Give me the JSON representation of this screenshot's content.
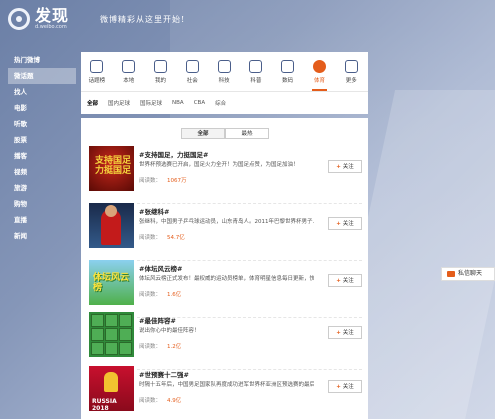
{
  "header": {
    "title": "发现",
    "subtitle": "d.weibo.com",
    "slogan": "微博精彩从这里开始!"
  },
  "sidebar": {
    "items": [
      {
        "label": "热门微博"
      },
      {
        "label": "微话题",
        "active": true
      },
      {
        "label": "找人"
      },
      {
        "label": "电影"
      },
      {
        "label": "听歌"
      },
      {
        "label": "股票"
      },
      {
        "label": "播客"
      },
      {
        "label": "视频"
      },
      {
        "label": "旅游"
      },
      {
        "label": "购物"
      },
      {
        "label": "直播"
      },
      {
        "label": "新闻"
      }
    ]
  },
  "categories": {
    "items": [
      {
        "label": "话题榜",
        "icon": "trophy-icon"
      },
      {
        "label": "本地",
        "icon": "location-icon"
      },
      {
        "label": "我的",
        "icon": "user-icon"
      },
      {
        "label": "社会",
        "icon": "globe-icon"
      },
      {
        "label": "科技",
        "icon": "ie-icon"
      },
      {
        "label": "科普",
        "icon": "book-icon"
      },
      {
        "label": "数码",
        "icon": "phone-icon"
      },
      {
        "label": "体育",
        "icon": "ball-icon",
        "selected": true
      },
      {
        "label": "更多",
        "icon": "more-icon"
      }
    ]
  },
  "subcats": {
    "items": [
      {
        "label": "全部",
        "selected": true
      },
      {
        "label": "国内足球"
      },
      {
        "label": "国际足球"
      },
      {
        "label": "NBA"
      },
      {
        "label": "CBA"
      },
      {
        "label": "综合"
      }
    ]
  },
  "tabs": {
    "all": "全部",
    "hot": "最热"
  },
  "topics": [
    {
      "title": "#支持国足，力挺国足#",
      "desc": "世界杯预选赛已开启，国足火力全开！为国足点赞，为国足加油！",
      "reads_label": "阅读数：",
      "reads": "1067万",
      "follow": "关注",
      "thumb_text": "支持国足力挺国足"
    },
    {
      "title": "#张继科#",
      "desc": "张继科，中国男子乒乓球运动员，山东青岛人。2011年巴黎世界杯男子...",
      "reads_label": "阅读数：",
      "reads": "54.7亿",
      "follow": "关注"
    },
    {
      "title": "#体坛风云榜#",
      "desc": "体坛风云榜正式发布！最权威的运动员榜单，体育明星信息每日更新，快...",
      "reads_label": "阅读数：",
      "reads": "1.6亿",
      "follow": "关注",
      "thumb_text": "体坛风云榜"
    },
    {
      "title": "#最佳阵容#",
      "desc": "说出你心中的最佳阵容！",
      "reads_label": "阅读数：",
      "reads": "1.2亿",
      "follow": "关注"
    },
    {
      "title": "#世预赛十二强#",
      "desc": "时隔十五年后，中国男足国家队再度成功进军世界杯亚洲区预选赛的最后...",
      "reads_label": "阅读数：",
      "reads": "4.9亿",
      "follow": "关注",
      "thumb_text": "RUSSIA 2018"
    }
  ],
  "private_message": "私信聊天",
  "colors": {
    "accent": "#e45d1b",
    "sidebar_bg": "#7385ab"
  }
}
